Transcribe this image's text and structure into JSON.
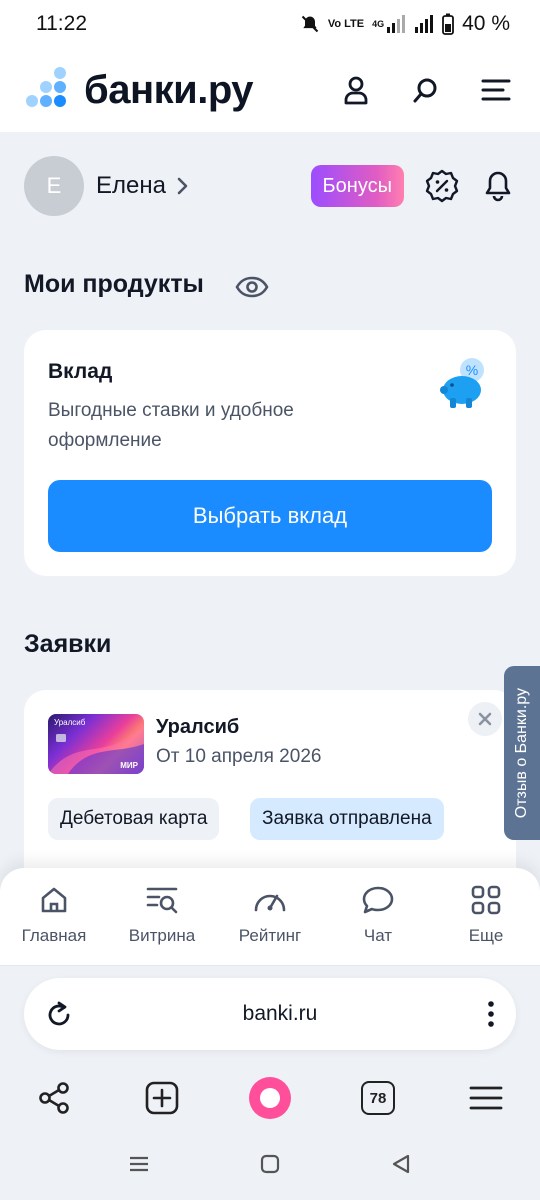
{
  "status": {
    "time": "11:22",
    "network": "Vo LTE",
    "network_gen": "4G",
    "battery": "40 %"
  },
  "header": {
    "logo_text": "банки.ру"
  },
  "profile": {
    "initial": "Е",
    "name": "Елена",
    "bonus_label": "Бонусы"
  },
  "products": {
    "title": "Мои продукты",
    "card": {
      "title": "Вклад",
      "description": "Выгодные ставки и удобное оформление",
      "button_label": "Выбрать вклад"
    }
  },
  "applications": {
    "title": "Заявки",
    "item": {
      "card_brand": "Уралсиб",
      "card_network": "МИР",
      "bank": "Уралсиб",
      "date": "От 10 апреля 2026",
      "type": "Дебетовая карта",
      "status": "Заявка отправлена"
    }
  },
  "feedback_tab": "Отзыв о Банки.ру",
  "bottom_nav": [
    {
      "label": "Главная",
      "icon": "home-icon"
    },
    {
      "label": "Витрина",
      "icon": "showcase-icon"
    },
    {
      "label": "Рейтинг",
      "icon": "gauge-icon"
    },
    {
      "label": "Чат",
      "icon": "chat-icon"
    },
    {
      "label": "Еще",
      "icon": "grid-icon"
    }
  ],
  "browser": {
    "url": "banki.ru",
    "tabs_count": "78"
  },
  "colors": {
    "primary": "#1b8cff",
    "bonus_gradient_start": "#9b4dff",
    "bonus_gradient_end": "#ff7fb0",
    "alisa": "#ff4f9a"
  }
}
